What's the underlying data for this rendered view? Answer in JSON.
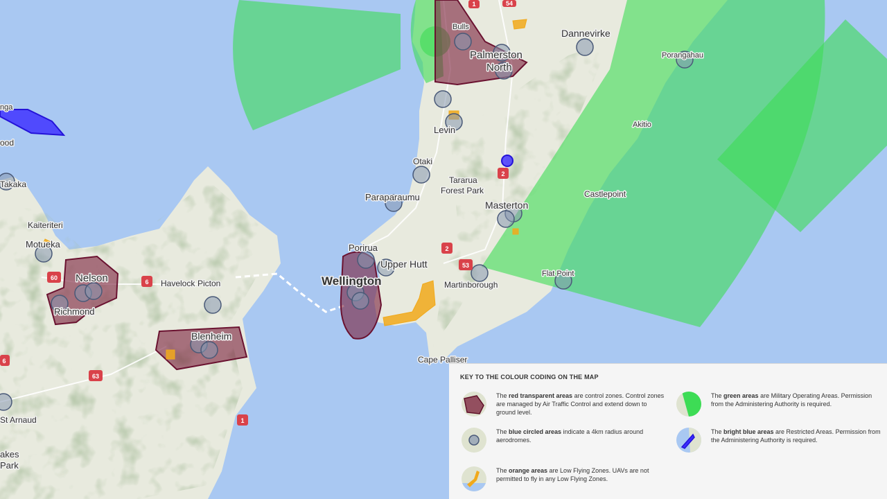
{
  "places": {
    "dannevirke": "Dannevirke",
    "porangahau": "Porangahau",
    "palmerston": "Palmerston",
    "north": "North",
    "levin": "Levin",
    "otaki": "Otaki",
    "tararua": "Tararua",
    "forest_park": "Forest Park",
    "paraparaumu": "Paraparaumu",
    "masterton": "Masterton",
    "castlepoint": "Castlepoint",
    "akitio": "Akitio",
    "porirua": "Porirua",
    "upper_hutt": "Upper Hutt",
    "wellington": "Wellington",
    "martinborough": "Martinborough",
    "flat_point": "Flat Point",
    "cape_palliser": "Cape Palliser",
    "nelson": "Nelson",
    "richmond": "Richmond",
    "havelock": "Havelock",
    "picton": "Picton",
    "blenheim": "Blenheim",
    "kaiteriteri": "Kaiteriteri",
    "motueka": "Motueka",
    "takaka": "Takaka",
    "st_arnaud": "St Arnaud",
    "wood_partial": "ood",
    "nga_partial": "nga",
    "lakes_partial": "akes",
    "park_partial": "Park",
    "bulls_partial": "Bulls"
  },
  "highways": {
    "sh2_a": "2",
    "sh2_b": "2",
    "sh53": "53",
    "sh54": "54",
    "sh1_top": "1",
    "sh1_south": "1",
    "sh60": "60",
    "sh6_a": "6",
    "sh6_b": "6",
    "sh63": "63"
  },
  "legend": {
    "title": "KEY TO THE COLOUR CODING ON THE MAP",
    "items": [
      {
        "bold": "red transparent areas",
        "pre": "The ",
        "post": " are control zones. Control zones are managed by Air Traffic Control and extend down to ground level."
      },
      {
        "bold": "green areas",
        "pre": "The ",
        "post": " are Military Operating Areas. Permission from the Administering Authority is required."
      },
      {
        "bold": "blue circled areas",
        "pre": "The ",
        "post": " indicate a 4km radius around aerodromes."
      },
      {
        "bold": "bright blue areas",
        "pre": "The ",
        "post": " are Restricted Areas. Permission from the Administering Authority is required."
      },
      {
        "bold": "orange areas",
        "pre": "The ",
        "post": " are Low Flying Zones. UAVs are not permitted to fly in any Low Flying Zones."
      }
    ]
  },
  "colors": {
    "sea": "#a9c8f2",
    "land": "#e8eade",
    "mountain": "#7e9c6a",
    "control_zone": "#7a1e3a",
    "military_area": "#3ddc55",
    "aerodrome": "#8797b0",
    "restricted": "#3a2bff",
    "low_flying": "#f1a91b"
  }
}
